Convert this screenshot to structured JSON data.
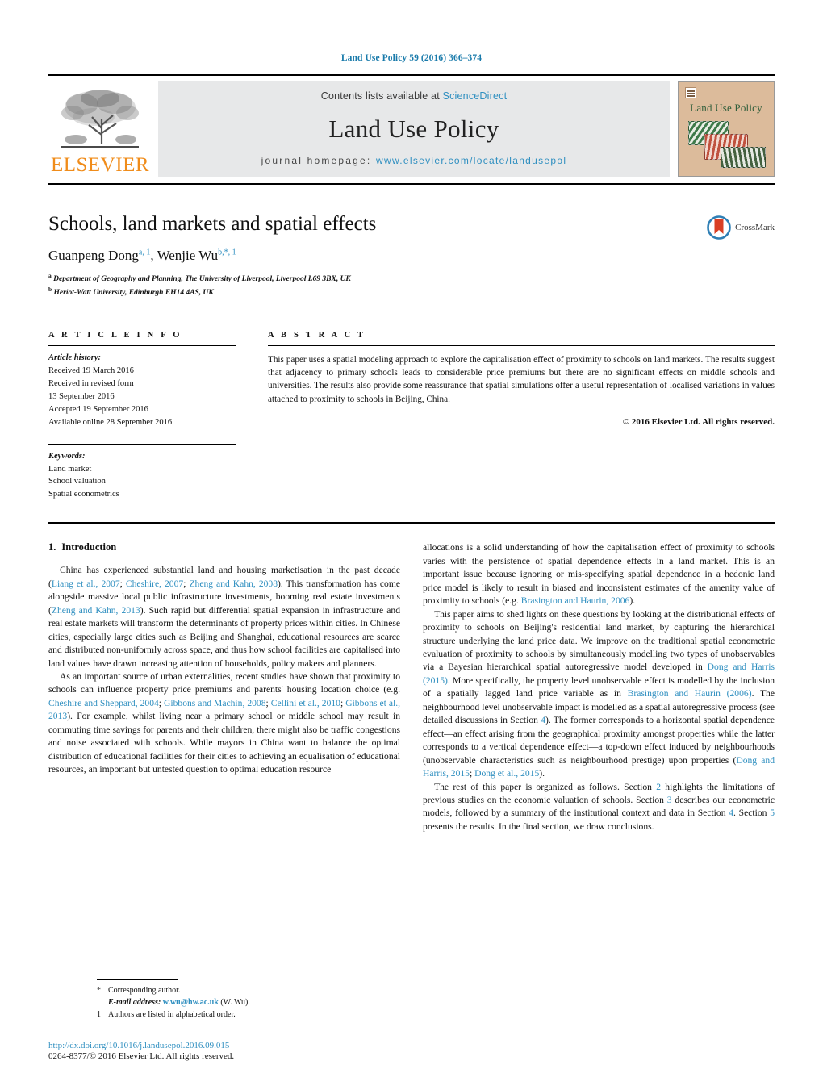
{
  "running_head": "Land Use Policy 59 (2016) 366–374",
  "masthead": {
    "publisher_name": "ELSEVIER",
    "contents_prefix": "Contents lists available at ",
    "contents_link": "ScienceDirect",
    "journal_name": "Land Use Policy",
    "homepage_label": "journal homepage:",
    "homepage_url": "www.elsevier.com/locate/landusepol",
    "cover_title": "Land Use Policy"
  },
  "article": {
    "title": "Schools, land markets and spatial effects",
    "authors": [
      {
        "name": "Guanpeng Dong",
        "marks": "a, 1"
      },
      {
        "name": "Wenjie Wu",
        "marks": "b,*, 1"
      }
    ],
    "authors_separator": ", ",
    "affiliations": [
      {
        "mark": "a",
        "text": "Department of Geography and Planning, The University of Liverpool, Liverpool L69 3BX, UK"
      },
      {
        "mark": "b",
        "text": "Heriot-Watt University, Edinburgh EH14 4AS, UK"
      }
    ],
    "crossmark_label": "CrossMark"
  },
  "article_info": {
    "heading": "A R T I C L E   I N F O",
    "history_label": "Article history:",
    "history_lines": [
      "Received 19 March 2016",
      "Received in revised form",
      "13 September 2016",
      "Accepted 19 September 2016",
      "Available online 28 September 2016"
    ],
    "keywords_label": "Keywords:",
    "keywords": [
      "Land market",
      "School valuation",
      "Spatial econometrics"
    ]
  },
  "abstract": {
    "heading": "A B S T R A C T",
    "text": "This paper uses a spatial modeling approach to explore the capitalisation effect of proximity to schools on land markets. The results suggest that adjacency to primary schools leads to considerable price premiums but there are no significant effects on middle schools and universities. The results also provide some reassurance that spatial simulations offer a useful representation of localised variations in values attached to proximity to schools in Beijing, China.",
    "copyright": "© 2016 Elsevier Ltd. All rights reserved."
  },
  "body": {
    "section_number": "1.",
    "section_title": "Introduction",
    "left_paragraphs": [
      "China has experienced substantial land and housing marketisation in the past decade (Liang et al., 2007; Cheshire, 2007; Zheng and Kahn, 2008). This transformation has come alongside massive local public infrastructure investments, booming real estate investments (Zheng and Kahn, 2013). Such rapid but differential spatial expansion in infrastructure and real estate markets will transform the determinants of property prices within cities. In Chinese cities, especially large cities such as Beijing and Shanghai, educational resources are scarce and distributed non-uniformly across space, and thus how school facilities are capitalised into land values have drawn increasing attention of households, policy makers and planners.",
      "As an important source of urban externalities, recent studies have shown that proximity to schools can influence property price premiums and parents' housing location choice (e.g. Cheshire and Sheppard, 2004; Gibbons and Machin, 2008; Cellini et al., 2010; Gibbons et al., 2013). For example, whilst living near a primary school or middle school may result in commuting time savings for parents and their children, there might also be traffic congestions and noise associated with schools. While mayors in China want to balance the optimal distribution of educational facilities for their cities to achieving an equalisation of educational resources, an important but untested question to optimal education resource"
    ],
    "right_paragraphs": [
      "allocations is a solid understanding of how the capitalisation effect of proximity to schools varies with the persistence of spatial dependence effects in a land market. This is an important issue because ignoring or mis-specifying spatial dependence in a hedonic land price model is likely to result in biased and inconsistent estimates of the amenity value of proximity to schools (e.g. Brasington and Haurin, 2006).",
      "This paper aims to shed lights on these questions by looking at the distributional effects of proximity to schools on Beijing's residential land market, by capturing the hierarchical structure underlying the land price data. We improve on the traditional spatial econometric evaluation of proximity to schools by simultaneously modelling two types of unobservables via a Bayesian hierarchical spatial autoregressive model developed in Dong and Harris (2015). More specifically, the property level unobservable effect is modelled by the inclusion of a spatially lagged land price variable as in Brasington and Haurin (2006). The neighbourhood level unobservable impact is modelled as a spatial autoregressive process (see detailed discussions in Section 4). The former corresponds to a horizontal spatial dependence effect—an effect arising from the geographical proximity amongst properties while the latter corresponds to a vertical dependence effect—a top-down effect induced by neighbourhoods (unobservable characteristics such as neighbourhood prestige) upon properties (Dong and Harris, 2015; Dong et al., 2015).",
      "The rest of this paper is organized as follows. Section 2 highlights the limitations of previous studies on the economic valuation of schools. Section 3 describes our econometric models, followed by a summary of the institutional context and data in Section 4. Section 5 presents the results. In the final section, we draw conclusions."
    ]
  },
  "footnotes": {
    "corresponding_mark": "*",
    "corresponding_text": "Corresponding author.",
    "email_label": "E-mail address:",
    "email": "w.wu@hw.ac.uk",
    "email_suffix": "(W. Wu).",
    "note_mark": "1",
    "note_text": "Authors are listed in alphabetical order."
  },
  "footer": {
    "doi": "http://dx.doi.org/10.1016/j.landusepol.2016.09.015",
    "issn_line": "0264-8377/© 2016 Elsevier Ltd. All rights reserved."
  },
  "colors": {
    "link": "#2f8fc0",
    "running_head": "#1a7bab",
    "elsevier_orange": "#f08c1a",
    "band_grey": "#e7e8e9",
    "cover_bg": "#dcbb9b",
    "cover_title_green": "#2f5d3a"
  }
}
